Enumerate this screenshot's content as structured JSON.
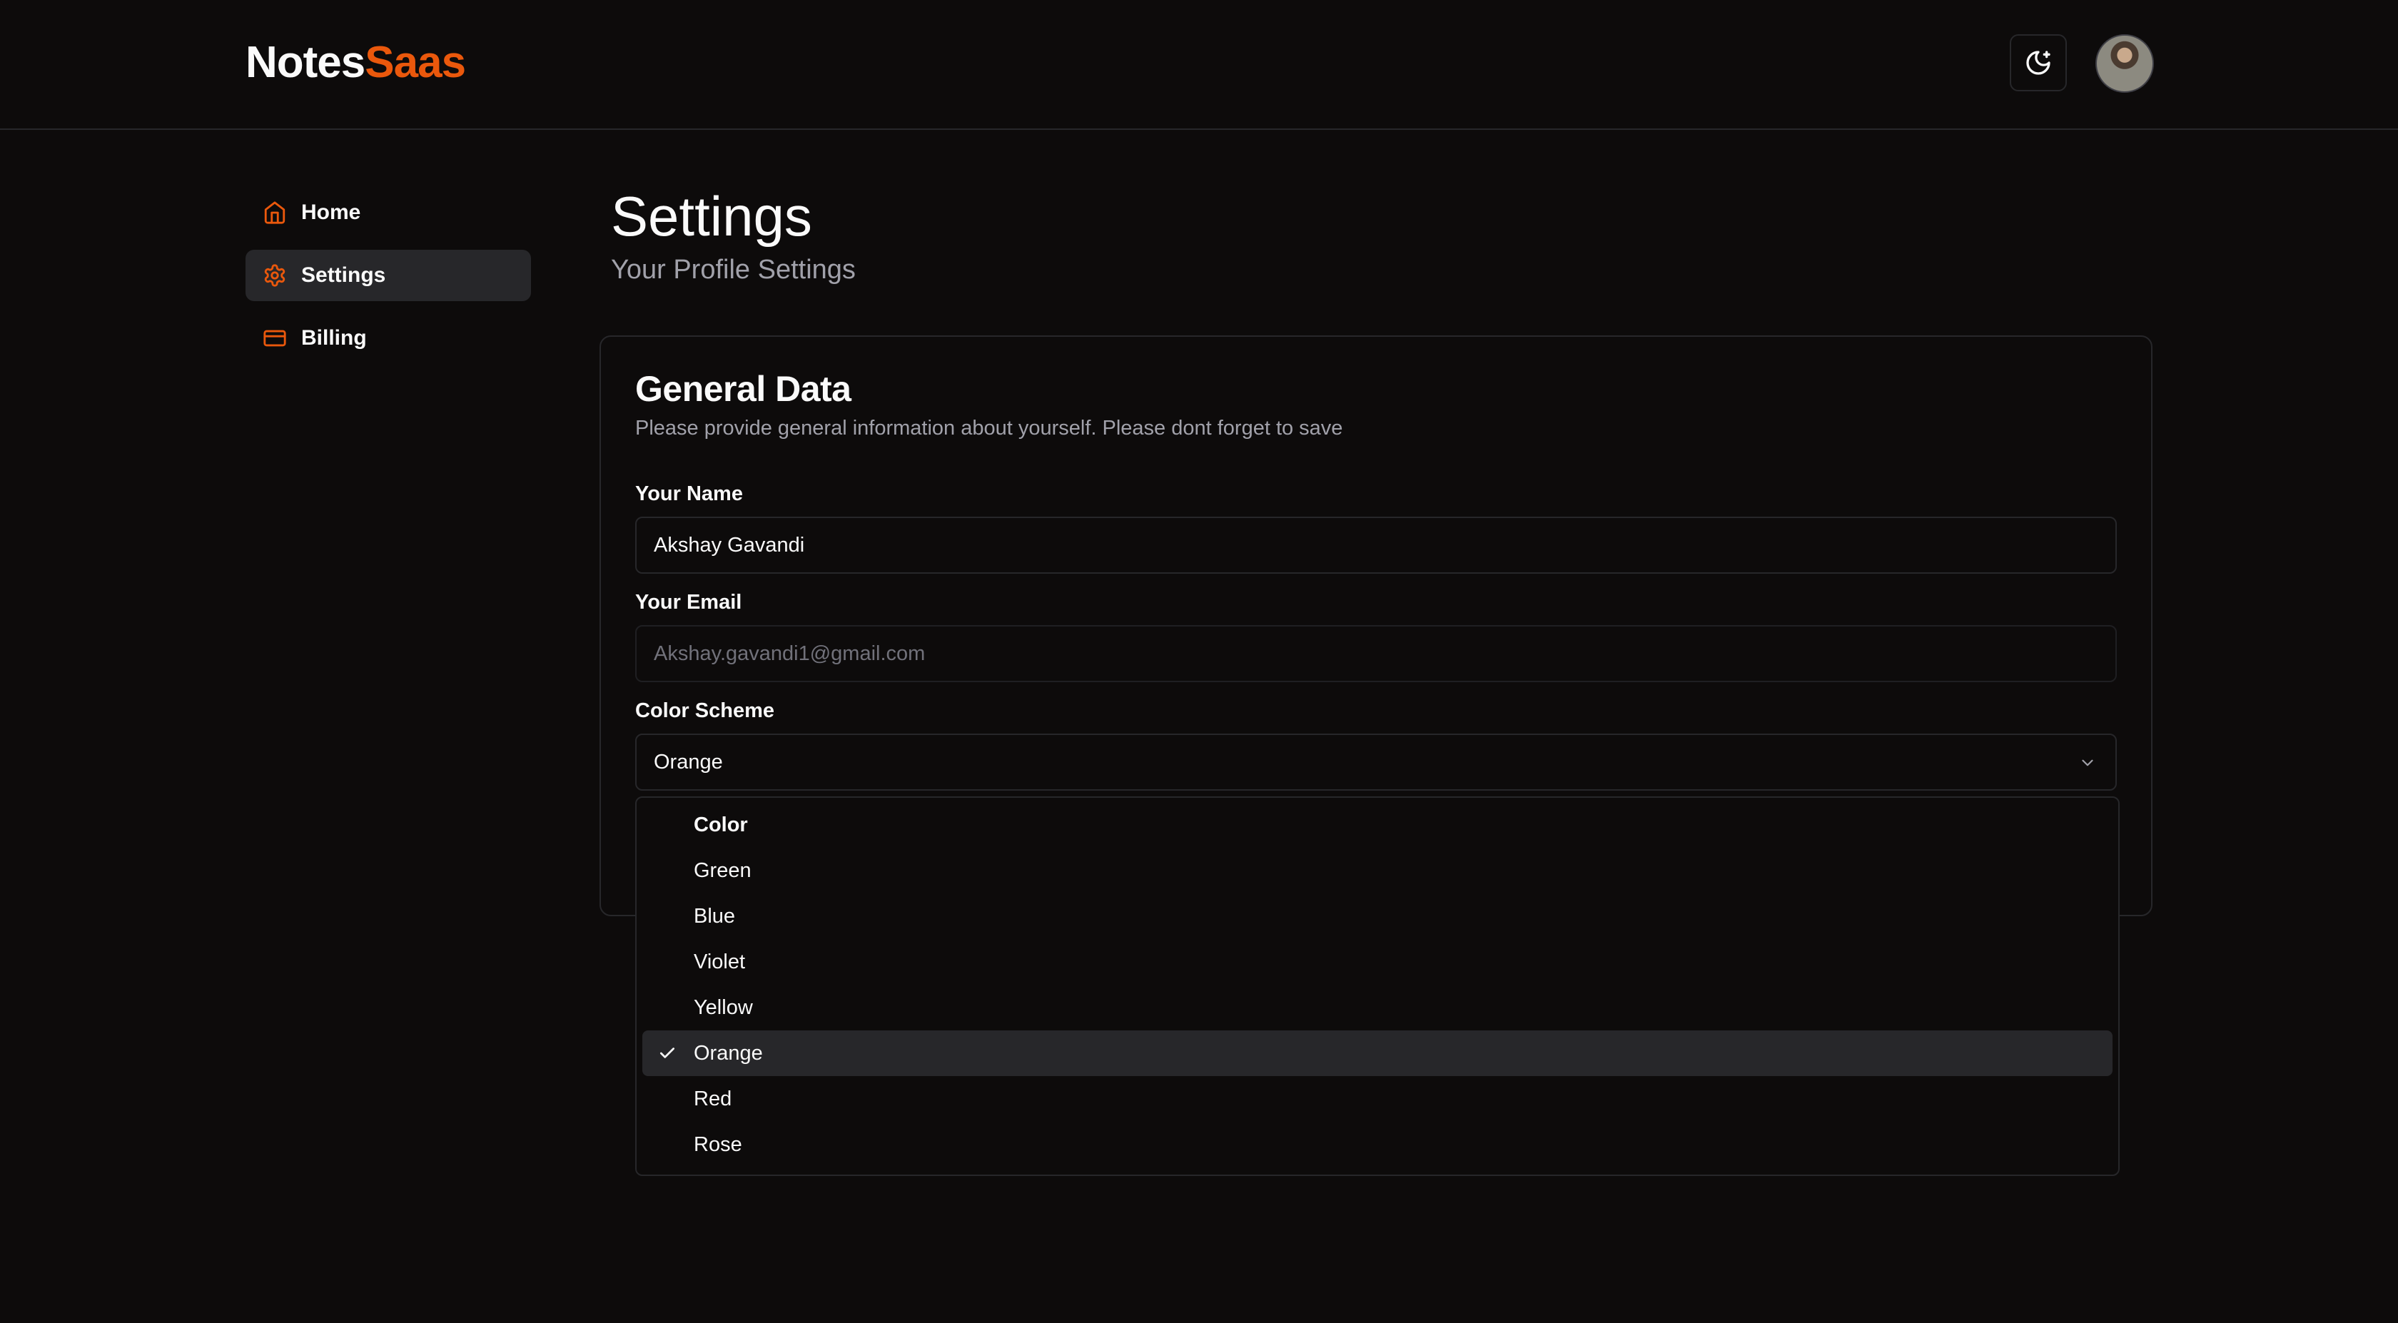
{
  "brand": {
    "name_part1": "Notes",
    "name_part2": "Saas",
    "accent_color": "#ea580c"
  },
  "header": {
    "theme_toggle_icon": "moon-stars-icon",
    "avatar_alt": "User avatar"
  },
  "sidebar": {
    "items": [
      {
        "label": "Home",
        "icon": "home-icon",
        "active": false
      },
      {
        "label": "Settings",
        "icon": "gear-icon",
        "active": true
      },
      {
        "label": "Billing",
        "icon": "credit-card-icon",
        "active": false
      }
    ]
  },
  "page": {
    "title": "Settings",
    "subtitle": "Your Profile Settings"
  },
  "card": {
    "title": "General Data",
    "description": "Please provide general information about yourself. Please dont forget to save",
    "name_label": "Your Name",
    "name_value": "Akshay Gavandi",
    "email_label": "Your Email",
    "email_value": "Akshay.gavandi1@gmail.com",
    "color_label": "Color Scheme",
    "color_value": "Orange"
  },
  "dropdown": {
    "group_label": "Color",
    "options": [
      "Green",
      "Blue",
      "Violet",
      "Yellow",
      "Orange",
      "Red",
      "Rose"
    ],
    "selected": "Orange"
  }
}
